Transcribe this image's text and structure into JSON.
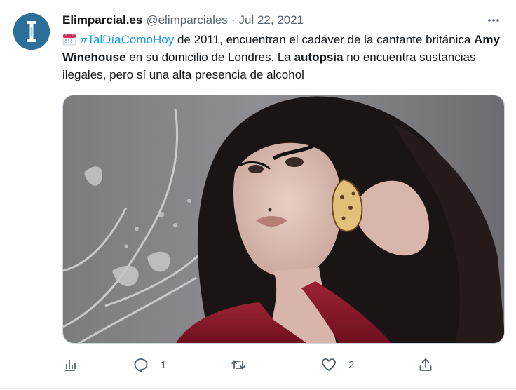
{
  "tweet": {
    "display_name": "Elimparcial.es",
    "handle": "@elimparciales",
    "separator": "·",
    "date": "Jul 22, 2021",
    "text": {
      "hashtag": "#TalDíaComoHoy",
      "part1": " de 2011, encuentran el cadáver de la cantante británica ",
      "bold1": "Amy Winehouse",
      "part2": " en su domicilio de Londres. La ",
      "bold2": "autopsia",
      "part3": " no encuentra sustancias ilegales, pero sí una alta presencia de alcohol"
    },
    "actions": {
      "replies": "1",
      "likes": "2"
    },
    "icons": [
      "calendar-icon",
      "more-icon",
      "analytics-icon",
      "reply-icon",
      "retweet-icon",
      "like-icon",
      "share-icon"
    ],
    "colors": {
      "accent": "#1d9bf0",
      "secondary_text": "#536471",
      "avatar_bg": "#2d6f9b"
    }
  }
}
